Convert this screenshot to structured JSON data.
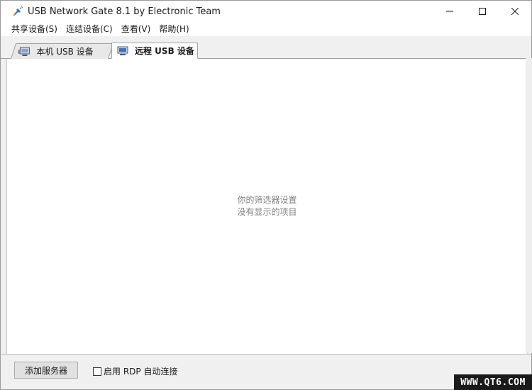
{
  "window": {
    "title": "USB Network Gate 8.1 by Electronic Team",
    "app_icon": "usb-plug-icon",
    "controls": [
      "minimize-icon",
      "maximize-icon",
      "close-icon"
    ]
  },
  "menu": {
    "items": [
      "共享设备(S)",
      "连结设备(C)",
      "查看(V)",
      "帮助(H)"
    ]
  },
  "tabs": [
    {
      "label": "本机 USB 设备",
      "icon": "local-computer-icon",
      "active": false
    },
    {
      "label": "远程 USB 设备",
      "icon": "remote-computer-icon",
      "active": true
    }
  ],
  "content": {
    "empty_line1": "你的筛选器设置",
    "empty_line2": "没有显示的项目"
  },
  "footer": {
    "add_server_label": "添加服务器",
    "rdp_label": "启用 RDP 自动连接",
    "rdp_checked": false
  },
  "watermark": "WWW.QT6.COM",
  "colors": {
    "window_bg": "#f0f0f0",
    "content_bg": "#ffffff",
    "hint_text": "#808080",
    "accent": "#3a6fc4"
  }
}
